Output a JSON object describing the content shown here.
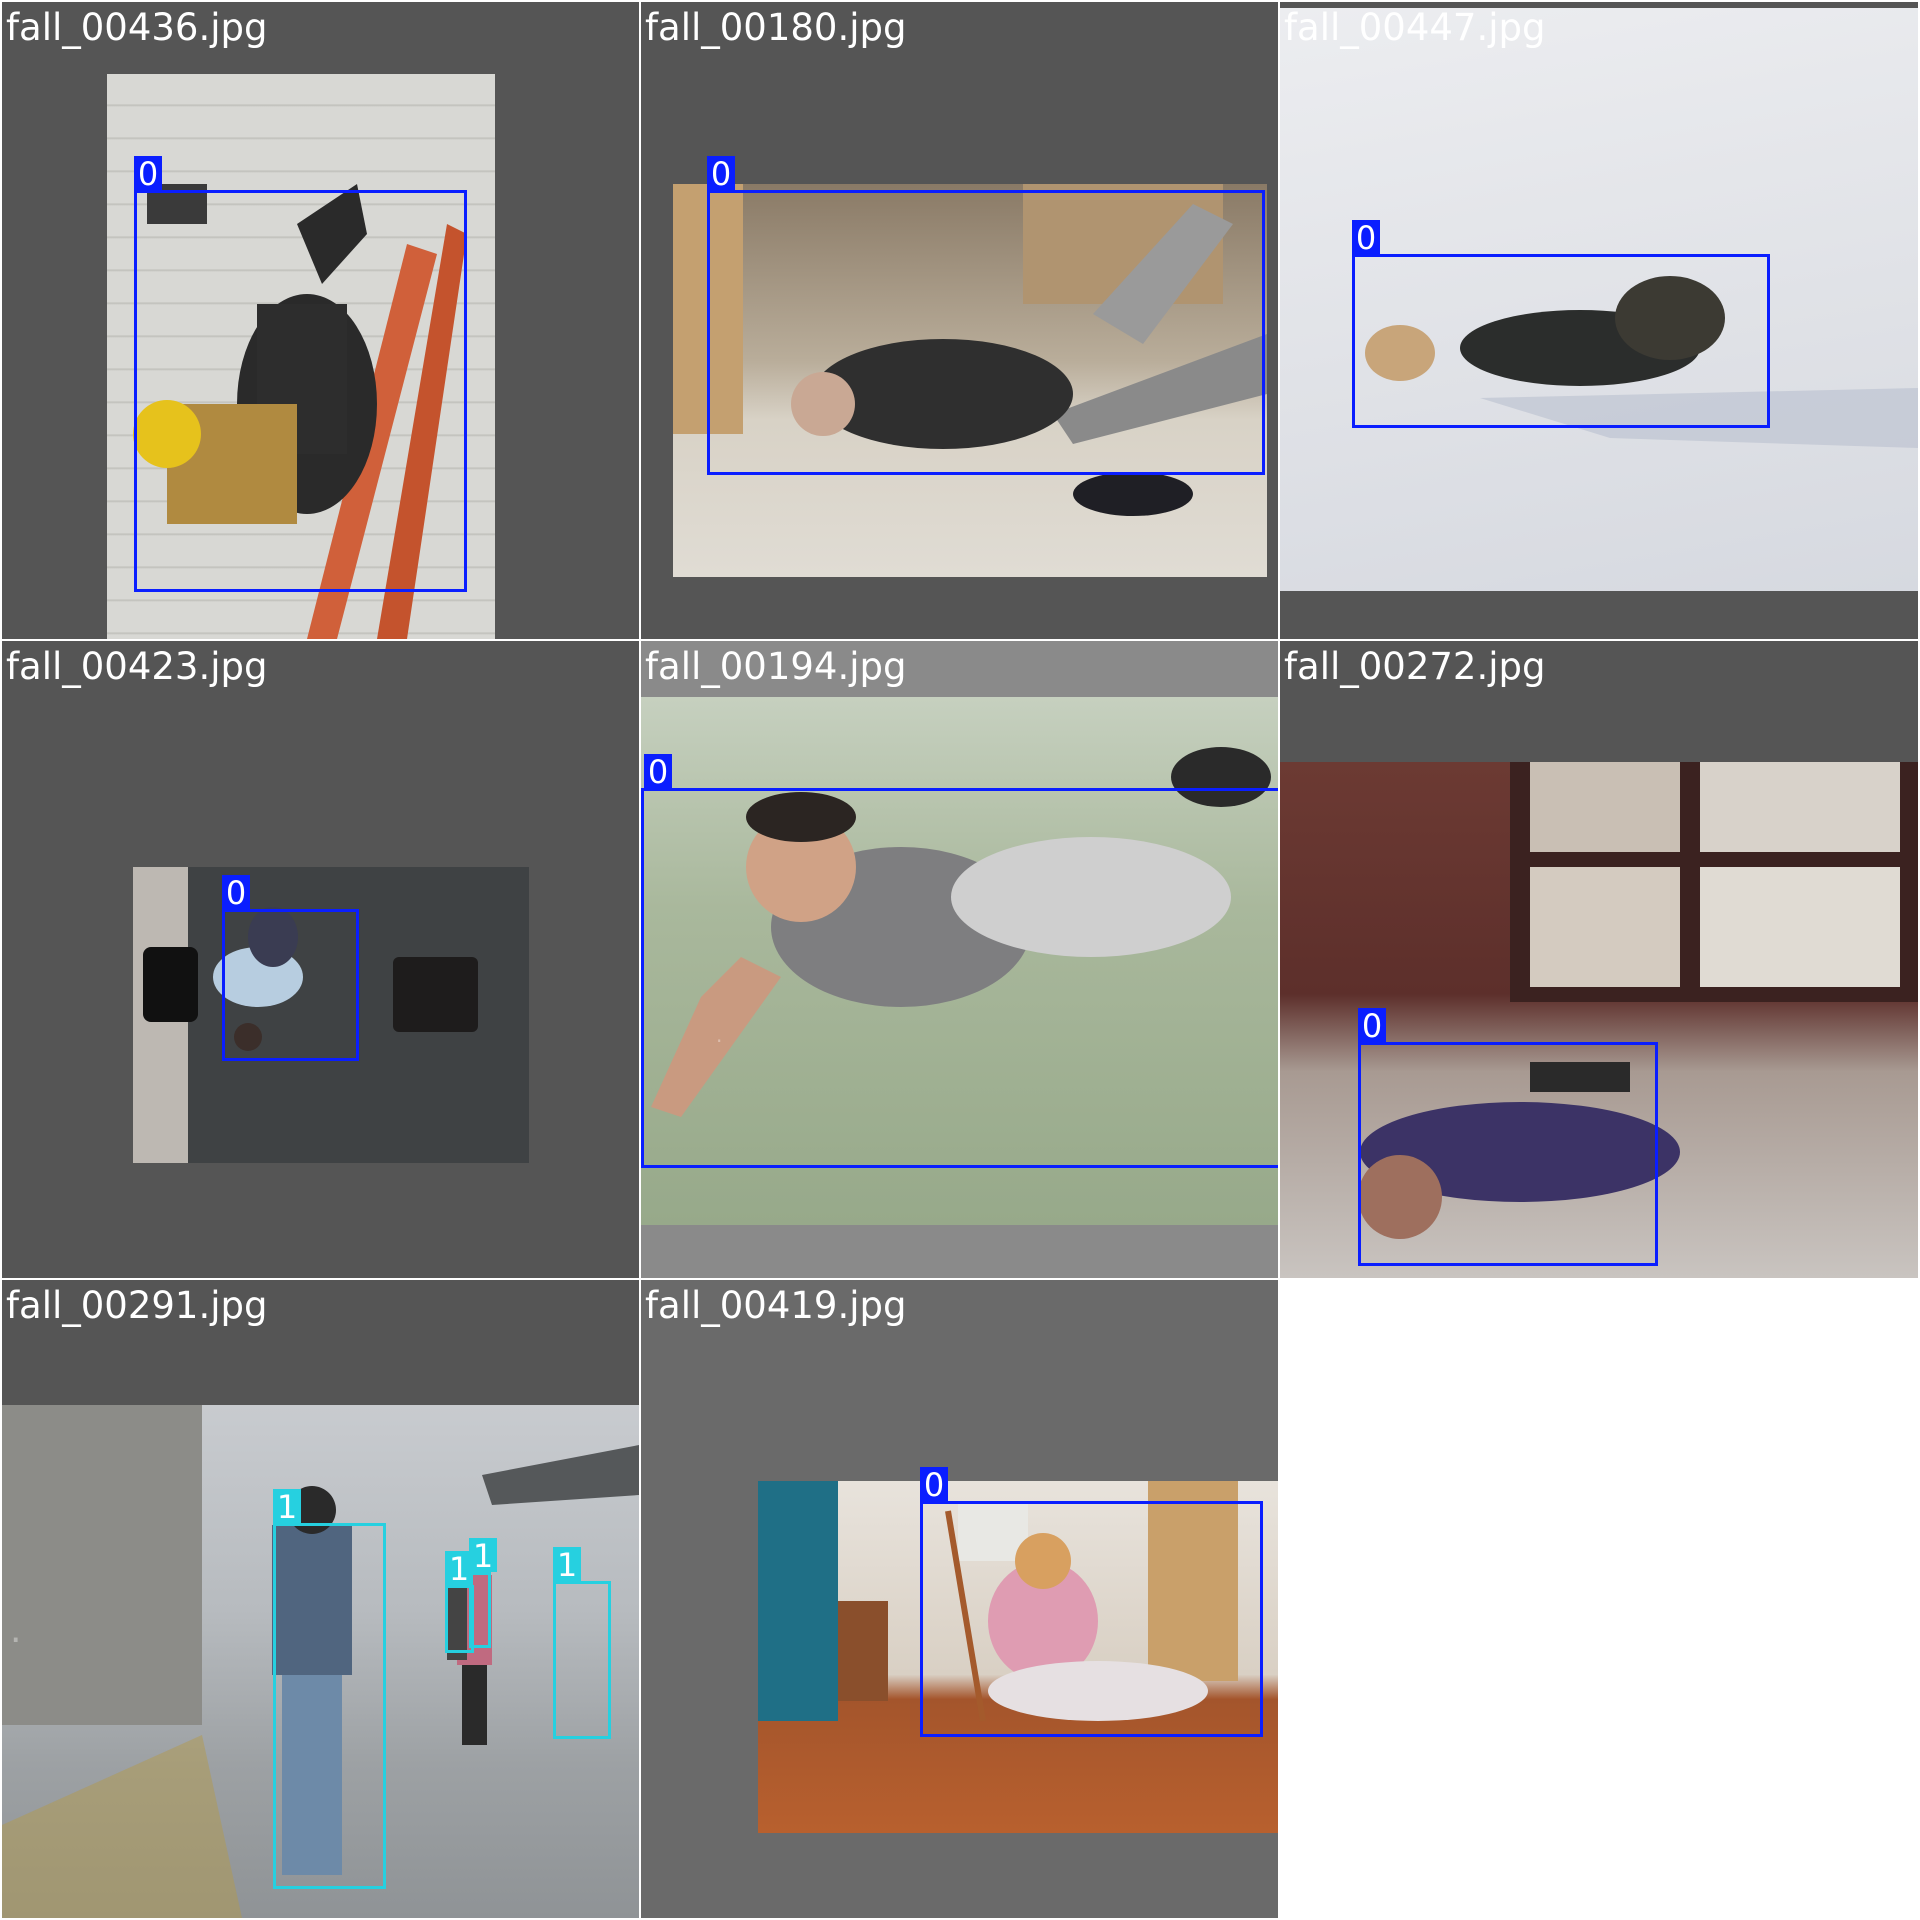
{
  "grid": {
    "background": "#ffffff",
    "tile_background": "#555555",
    "class_colors": {
      "0": "#0a1eff",
      "1": "#26d0e0"
    },
    "tiles": [
      {
        "filename": "fall_00436.jpg",
        "scene": "worker falling from ladder",
        "boxes": [
          {
            "label": "0"
          }
        ]
      },
      {
        "filename": "fall_00180.jpg",
        "scene": "elderly man fallen indoors",
        "boxes": [
          {
            "label": "0"
          }
        ]
      },
      {
        "filename": "fall_00447.jpg",
        "scene": "person fallen on snow",
        "boxes": [
          {
            "label": "0"
          }
        ]
      },
      {
        "filename": "fall_00423.jpg",
        "scene": "overhead view of person on floor",
        "boxes": [
          {
            "label": "0"
          }
        ]
      },
      {
        "filename": "fall_00194.jpg",
        "scene": "man fallen on grass",
        "boxes": [
          {
            "label": "0"
          }
        ]
      },
      {
        "filename": "fall_00272.jpg",
        "scene": "man lying on tiled floor",
        "boxes": [
          {
            "label": "0"
          }
        ]
      },
      {
        "filename": "fall_00291.jpg",
        "scene": "people standing on street",
        "boxes": [
          {
            "label": "1"
          },
          {
            "label": "1"
          },
          {
            "label": "1"
          },
          {
            "label": "1"
          }
        ]
      },
      {
        "filename": "fall_00419.jpg",
        "scene": "elderly woman fallen with cane",
        "boxes": [
          {
            "label": "0"
          }
        ]
      }
    ]
  }
}
